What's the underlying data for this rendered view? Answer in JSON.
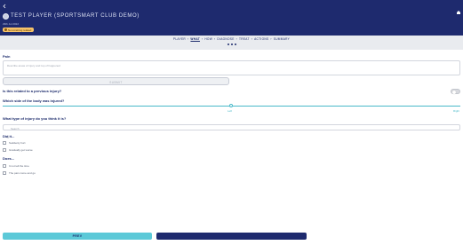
{
  "header": {
    "player_name": "Test Player (Sportsmart Club Demo)",
    "date": "29th Jul 2022",
    "tag": "Non-training related",
    "back_icon": "back-arrow-icon",
    "home_icon": "home-icon"
  },
  "steps": {
    "items": [
      {
        "label": "PLAYER",
        "active": false
      },
      {
        "label": "WHAT",
        "active": true
      },
      {
        "label": "HOW",
        "active": false
      },
      {
        "label": "DIAGNOSE",
        "active": false
      },
      {
        "label": "TREAT",
        "active": false
      },
      {
        "label": "ACTIONS",
        "active": false
      },
      {
        "label": "SUMMARY",
        "active": false
      }
    ],
    "separator": "›",
    "pagination": {
      "count": 3,
      "current": 3
    }
  },
  "pain": {
    "label": "Pain",
    "placeholder": "Describe areas of injury and top of happened",
    "submit_label": "SUBMIT"
  },
  "previous_injury": {
    "question": "Is this related to a previous injury?",
    "toggle_on": false
  },
  "side": {
    "question": "Which side of the body was injured?",
    "left_label": "Left",
    "right_label": "Right"
  },
  "injury_type": {
    "question": "What type of injury do you think it is?",
    "search_placeholder": "Search"
  },
  "did_it": {
    "heading": "Did it...",
    "options": [
      "Suddenly hurt",
      "Gradually get worse"
    ]
  },
  "does": {
    "heading": "Does...",
    "options": [
      "It not tell the time",
      "The pain come and go"
    ]
  },
  "footer": {
    "prev_label": "PREV",
    "next_icon": "arrow-right-icon"
  },
  "colors": {
    "header_bg": "#1e2a6e",
    "accent": "#5cc9d8",
    "tag_bg": "#f6c36a"
  }
}
